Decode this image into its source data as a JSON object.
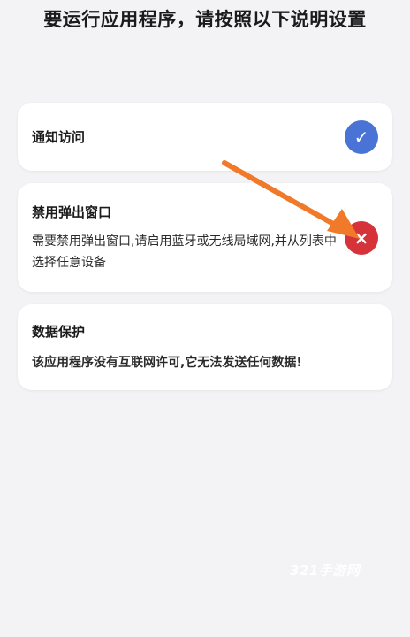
{
  "header": {
    "title": "要运行应用程序，请按照以下说明设置"
  },
  "permissions": [
    {
      "title": "通知访问",
      "description": "",
      "status": "granted",
      "status_icon": "check-icon",
      "status_glyph": "✓",
      "status_color": "#4a73d6"
    },
    {
      "title": "禁用弹出窗口",
      "description": "需要禁用弹出窗口,请启用蓝牙或无线局域网,并从列表中选择任意设备",
      "status": "denied",
      "status_icon": "close-icon",
      "status_glyph": "×",
      "status_color": "#d6323a"
    },
    {
      "title": "数据保护",
      "description": "该应用程序没有互联网许可,它无法发送任何数据!"
    }
  ],
  "annotation": {
    "arrow_icon": "orange-arrow-icon",
    "arrow_color": "#f07a2a"
  },
  "watermark": {
    "text": "321手游网"
  }
}
